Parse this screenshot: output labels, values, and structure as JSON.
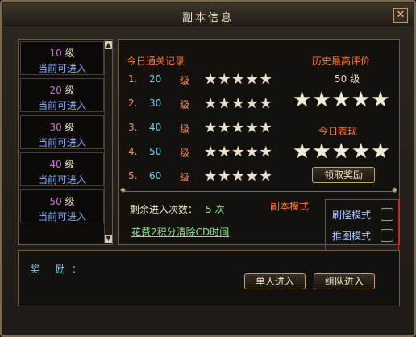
{
  "window": {
    "title": "副本信息",
    "close_symbol": "✕"
  },
  "levels": [
    {
      "num": "10",
      "unit": "级",
      "status": "当前可进入"
    },
    {
      "num": "20",
      "unit": "级",
      "status": "当前可进入"
    },
    {
      "num": "30",
      "unit": "级",
      "status": "当前可进入"
    },
    {
      "num": "40",
      "unit": "级",
      "status": "当前可进入"
    },
    {
      "num": "50",
      "unit": "级",
      "status": "当前可进入"
    }
  ],
  "scroll": {
    "up": "▲",
    "down": "▼"
  },
  "records": {
    "title": "今日通关记录",
    "rows": [
      {
        "idx": "1.",
        "lv": "20",
        "unit": "级",
        "stars": 5
      },
      {
        "idx": "2.",
        "lv": "30",
        "unit": "级",
        "stars": 5
      },
      {
        "idx": "3.",
        "lv": "40",
        "unit": "级",
        "stars": 5
      },
      {
        "idx": "4.",
        "lv": "50",
        "unit": "级",
        "stars": 5
      },
      {
        "idx": "5.",
        "lv": "60",
        "unit": "级",
        "stars": 5
      }
    ]
  },
  "history": {
    "title": "历史最高评价",
    "level": "50 级",
    "stars": 5
  },
  "today": {
    "title": "今日表现",
    "stars": 5,
    "claim_label": "领取奖励"
  },
  "remaining": {
    "label": "剩余进入次数：",
    "count": "5 次"
  },
  "cd_link": "花费2积分清除CD时间",
  "mode": {
    "title": "副本模式",
    "options": [
      {
        "label": "刷怪模式",
        "checked": false
      },
      {
        "label": "推图模式",
        "checked": false
      }
    ]
  },
  "reward": {
    "label": "奖 励："
  },
  "buttons": {
    "single": "单人进入",
    "team": "组队进入"
  },
  "colors": {
    "accent_orange": "#ff7a30",
    "level_purple": "#d070e0",
    "link_green": "#8fe08f",
    "highlight_red": "#d02020"
  }
}
